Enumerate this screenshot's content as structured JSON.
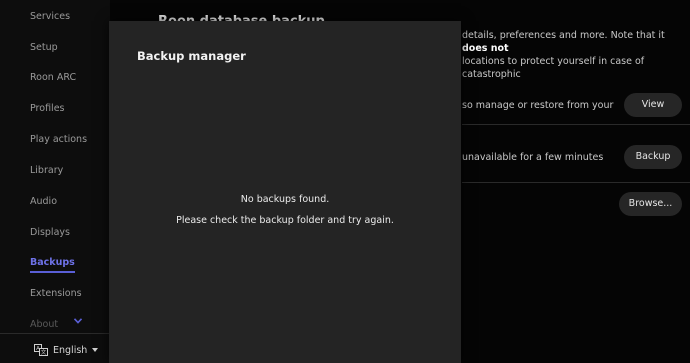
{
  "sidebar": {
    "items": [
      {
        "label": "Services"
      },
      {
        "label": "Setup"
      },
      {
        "label": "Roon ARC"
      },
      {
        "label": "Profiles"
      },
      {
        "label": "Play actions"
      },
      {
        "label": "Library"
      },
      {
        "label": "Audio"
      },
      {
        "label": "Displays"
      },
      {
        "label": "Backups"
      },
      {
        "label": "Extensions"
      },
      {
        "label": "About"
      }
    ],
    "active_item": "Backups",
    "language": "English",
    "language_icon": "translate-icon",
    "expand_icon": "chevron-down-icon"
  },
  "main": {
    "heading": "Roon database backup",
    "description_part1": "details, preferences and more. Note that it",
    "description_bold": "does not",
    "description_part2": "locations to protect yourself in case of catastrophic",
    "rows": [
      {
        "text": "so manage or restore from your",
        "button": "View"
      },
      {
        "text": "unavailable for a few minutes",
        "button": "Backup"
      },
      {
        "text": "",
        "button": "Browse..."
      }
    ]
  },
  "modal": {
    "title": "Backup manager",
    "message_line1": "No backups found.",
    "message_line2": "Please check the backup folder and try again."
  },
  "colors": {
    "accent": "#5a5fd6",
    "background": "#050505",
    "modal_bg": "#242424"
  }
}
